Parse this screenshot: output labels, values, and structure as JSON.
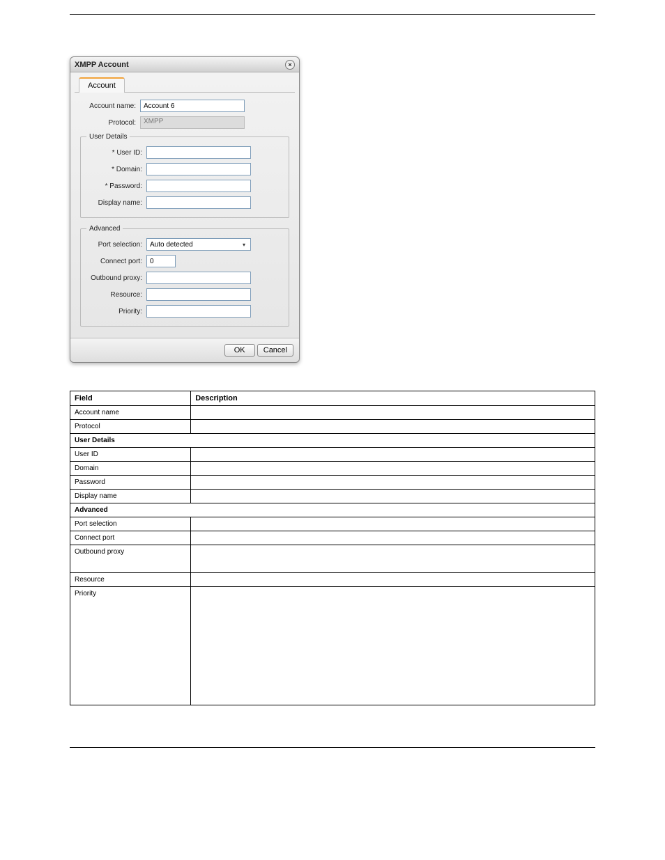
{
  "dialog": {
    "title": "XMPP Account",
    "tab": "Account",
    "account_name_label": "Account name:",
    "account_name_value": "Account 6",
    "protocol_label": "Protocol:",
    "protocol_value": "XMPP",
    "user_details_legend": "User Details",
    "user_id_label": "* User ID:",
    "user_id_value": "",
    "domain_label": "* Domain:",
    "domain_value": "",
    "password_label": "* Password:",
    "password_value": "",
    "display_name_label": "Display name:",
    "display_name_value": "",
    "advanced_legend": "Advanced",
    "port_selection_label": "Port selection:",
    "port_selection_value": "Auto detected",
    "connect_port_label": "Connect port:",
    "connect_port_value": "0",
    "outbound_proxy_label": "Outbound proxy:",
    "outbound_proxy_value": "",
    "resource_label": "Resource:",
    "resource_value": "",
    "priority_label": "Priority:",
    "priority_value": "",
    "ok": "OK",
    "cancel": "Cancel"
  },
  "table": {
    "head_field": "Field",
    "head_desc": "Description",
    "rows": [
      {
        "f": "Account name",
        "d": ""
      },
      {
        "f": "Protocol",
        "d": ""
      },
      {
        "section": "User Details"
      },
      {
        "f": "User ID",
        "d": ""
      },
      {
        "f": "Domain",
        "d": ""
      },
      {
        "f": "Password",
        "d": ""
      },
      {
        "f": "Display name",
        "d": ""
      },
      {
        "section": "Advanced"
      },
      {
        "f": "Port selection",
        "d": ""
      },
      {
        "f": "Connect port",
        "d": ""
      },
      {
        "f": "Outbound proxy",
        "d": "",
        "tall": true
      },
      {
        "f": "Resource",
        "d": ""
      },
      {
        "f": "Priority",
        "d": "",
        "verytall": true
      }
    ]
  }
}
